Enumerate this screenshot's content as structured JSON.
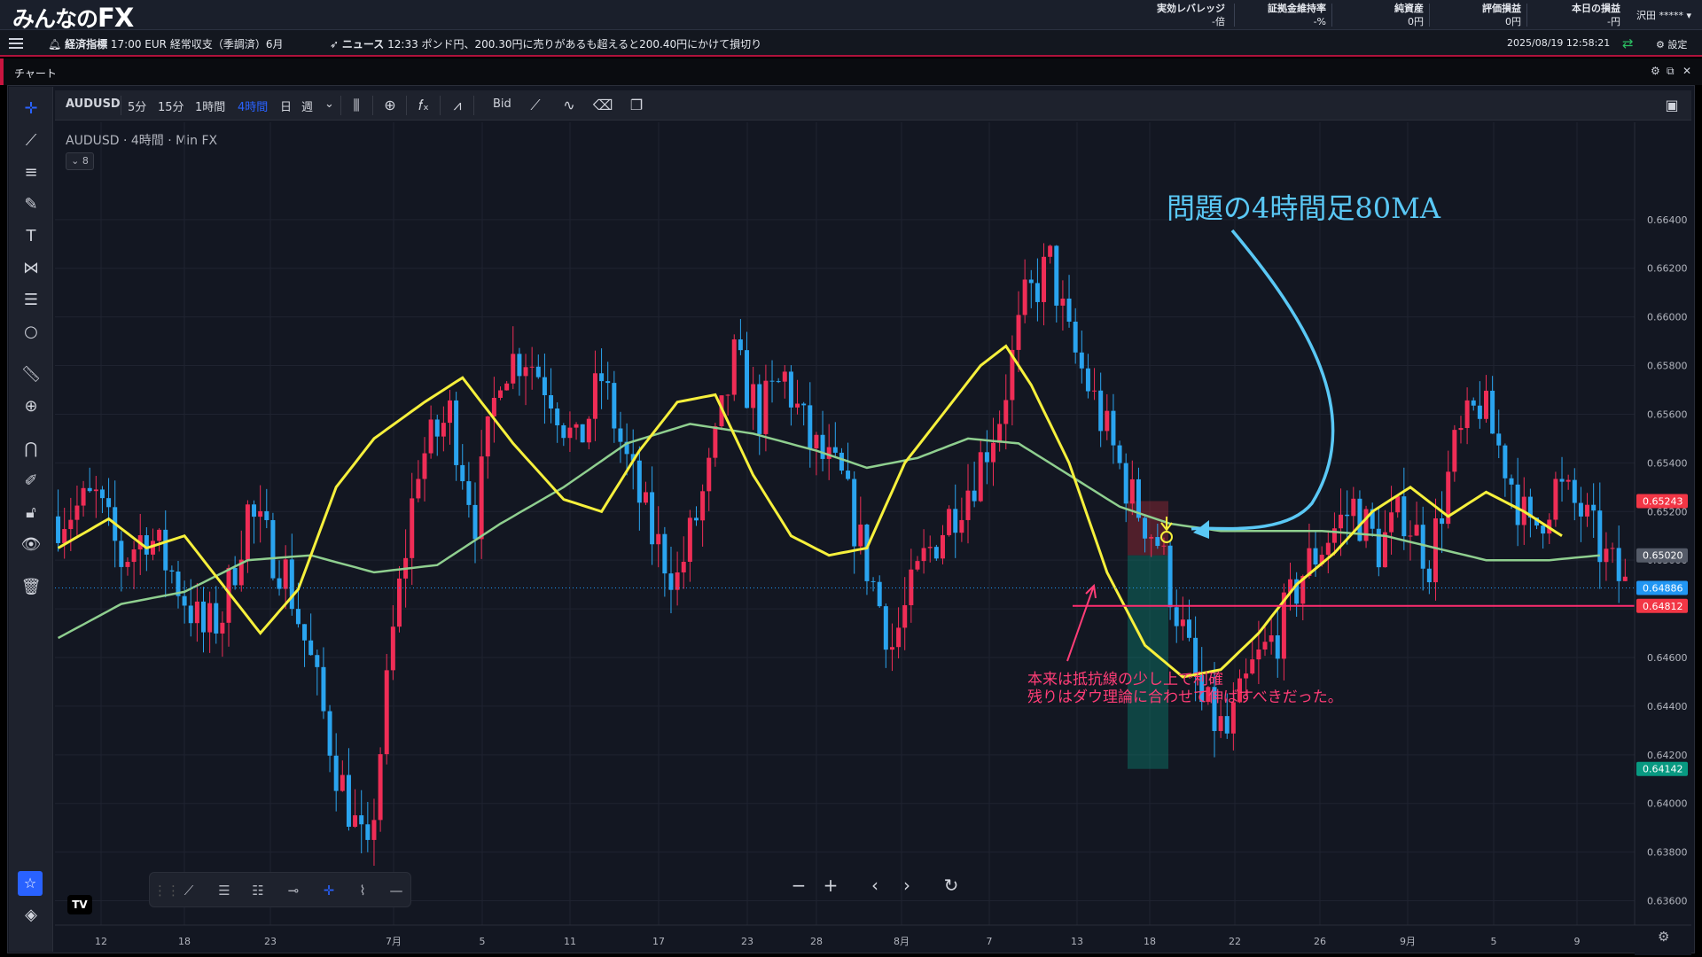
{
  "header": {
    "logo_prefix": "みんなの",
    "logo_suffix": "FX",
    "account": [
      {
        "label": "実効レバレッジ",
        "value": "-倍"
      },
      {
        "label": "証拠金維持率",
        "value": "-%"
      },
      {
        "label": "純資産",
        "value": "0円"
      },
      {
        "label": "評価損益",
        "value": "0円"
      },
      {
        "label": "本日の損益",
        "value": "-円"
      }
    ],
    "user": "沢田 ***** ▾"
  },
  "ticker": {
    "econ_label": "経済指標",
    "econ_text": "17:00 EUR 経常収支（季調済）6月",
    "news_label": "ニュース",
    "news_text": "12:33 ポンド円、200.30円に売りがあるも超えると200.40円にかけて損切り",
    "datetime": "2025/08/19 12:58:21",
    "settings": "設定"
  },
  "panel": {
    "title": "チャート"
  },
  "toolbar": {
    "symbol": "AUDUSD",
    "intervals": [
      "5分",
      "15分",
      "1時間",
      "4時間",
      "日",
      "週"
    ],
    "active_interval": "4時間",
    "price_source": "Bid"
  },
  "legend": {
    "symbol": "AUDUSD",
    "interval": "4時間",
    "source": "Min FX",
    "indicator_count": "8"
  },
  "colors": {
    "up": "#ef2d56",
    "down": "#2aa4ef",
    "ma_short": "#f6f03c",
    "ma_long": "#8fcf8f",
    "note_title": "#5ac8f5",
    "note_body": "#ff3d77",
    "support": "#ff2d6f"
  },
  "annotations": {
    "ma_note": "問題の4時間足80MA",
    "tp_note_line1": "本来は抵抗線の少し上で利確",
    "tp_note_line2": "残りはダウ理論に合わせて伸ばすべきだった。"
  },
  "chart_data": {
    "type": "candlestick",
    "symbol": "AUDUSD",
    "ylim": [
      0.635,
      0.668
    ],
    "y_ticks": [
      "0.66400",
      "0.66200",
      "0.66000",
      "0.65800",
      "0.65600",
      "0.65400",
      "0.65200",
      "0.65000",
      "0.64800",
      "0.64600",
      "0.64400",
      "0.64200",
      "0.64000",
      "0.63800",
      "0.63600"
    ],
    "x_ticks": [
      "12",
      "18",
      "23",
      "7月",
      "5",
      "11",
      "17",
      "23",
      "28",
      "8月",
      "7",
      "13",
      "18",
      "22",
      "26",
      "9月",
      "5",
      "9"
    ],
    "price_labels": [
      {
        "value": "0.65243",
        "color": "#f23645",
        "text_color": "#ffffff"
      },
      {
        "value": "0.65020",
        "color": "#555b68",
        "text_color": "#ffffff"
      },
      {
        "value": "0.64886",
        "color": "#2196f3",
        "text_color": "#ffffff"
      },
      {
        "value": "0.64812",
        "color": "#f23645",
        "text_color": "#ffffff"
      },
      {
        "value": "0.64142",
        "color": "#089981",
        "text_color": "#ffffff"
      }
    ],
    "support_level": 0.64812,
    "current_price": 0.64886,
    "position_box": {
      "entry": 0.6502,
      "stop": 0.65243,
      "target": 0.64142
    },
    "price_path": [
      [
        0,
        0.6518
      ],
      [
        6,
        0.6525
      ],
      [
        10,
        0.65
      ],
      [
        14,
        0.6512
      ],
      [
        18,
        0.6495
      ],
      [
        23,
        0.647
      ],
      [
        26,
        0.6478
      ],
      [
        30,
        0.652
      ],
      [
        36,
        0.6495
      ],
      [
        40,
        0.6458
      ],
      [
        44,
        0.6415
      ],
      [
        49,
        0.6375
      ],
      [
        53,
        0.647
      ],
      [
        57,
        0.654
      ],
      [
        62,
        0.656
      ],
      [
        66,
        0.6518
      ],
      [
        70,
        0.658
      ],
      [
        74,
        0.6585
      ],
      [
        78,
        0.657
      ],
      [
        82,
        0.6545
      ],
      [
        86,
        0.6575
      ],
      [
        90,
        0.654
      ],
      [
        94,
        0.651
      ],
      [
        98,
        0.6492
      ],
      [
        103,
        0.6535
      ],
      [
        107,
        0.6582
      ],
      [
        111,
        0.656
      ],
      [
        115,
        0.6575
      ],
      [
        119,
        0.6548
      ],
      [
        124,
        0.6532
      ],
      [
        128,
        0.6498
      ],
      [
        132,
        0.6465
      ],
      [
        137,
        0.65
      ],
      [
        141,
        0.6518
      ],
      [
        145,
        0.6535
      ],
      [
        149,
        0.656
      ],
      [
        153,
        0.6605
      ],
      [
        157,
        0.6622
      ],
      [
        160,
        0.659
      ],
      [
        163,
        0.6572
      ],
      [
        167,
        0.6545
      ],
      [
        170,
        0.6525
      ],
      [
        174,
        0.6508
      ],
      [
        178,
        0.647
      ],
      [
        181,
        0.644
      ],
      [
        185,
        0.6428
      ],
      [
        189,
        0.6455
      ],
      [
        193,
        0.647
      ],
      [
        197,
        0.6495
      ],
      [
        201,
        0.651
      ],
      [
        205,
        0.6522
      ],
      [
        209,
        0.6505
      ],
      [
        213,
        0.652
      ],
      [
        217,
        0.65
      ],
      [
        221,
        0.6545
      ],
      [
        225,
        0.6565
      ],
      [
        229,
        0.654
      ],
      [
        233,
        0.651
      ],
      [
        237,
        0.653
      ],
      [
        241,
        0.652
      ],
      [
        245,
        0.65
      ],
      [
        248,
        0.6489
      ]
    ],
    "ma_short_path": [
      [
        0,
        0.6505
      ],
      [
        8,
        0.6517
      ],
      [
        14,
        0.6505
      ],
      [
        20,
        0.651
      ],
      [
        26,
        0.649
      ],
      [
        32,
        0.647
      ],
      [
        38,
        0.6488
      ],
      [
        44,
        0.653
      ],
      [
        50,
        0.655
      ],
      [
        58,
        0.6565
      ],
      [
        64,
        0.6575
      ],
      [
        72,
        0.6548
      ],
      [
        80,
        0.6525
      ],
      [
        86,
        0.652
      ],
      [
        92,
        0.6545
      ],
      [
        98,
        0.6565
      ],
      [
        104,
        0.6568
      ],
      [
        110,
        0.6535
      ],
      [
        116,
        0.651
      ],
      [
        122,
        0.6502
      ],
      [
        128,
        0.6505
      ],
      [
        134,
        0.654
      ],
      [
        140,
        0.656
      ],
      [
        146,
        0.658
      ],
      [
        150,
        0.6588
      ],
      [
        154,
        0.6572
      ],
      [
        160,
        0.654
      ],
      [
        166,
        0.6495
      ],
      [
        172,
        0.6465
      ],
      [
        178,
        0.6452
      ],
      [
        184,
        0.6455
      ],
      [
        190,
        0.647
      ],
      [
        196,
        0.649
      ],
      [
        202,
        0.6503
      ],
      [
        208,
        0.652
      ],
      [
        214,
        0.653
      ],
      [
        220,
        0.6518
      ],
      [
        226,
        0.6528
      ],
      [
        232,
        0.652
      ],
      [
        238,
        0.651
      ]
    ],
    "ma_long_path": [
      [
        0,
        0.6468
      ],
      [
        10,
        0.6482
      ],
      [
        20,
        0.6487
      ],
      [
        30,
        0.65
      ],
      [
        40,
        0.6502
      ],
      [
        50,
        0.6495
      ],
      [
        60,
        0.6498
      ],
      [
        70,
        0.6515
      ],
      [
        80,
        0.653
      ],
      [
        90,
        0.6548
      ],
      [
        100,
        0.6556
      ],
      [
        110,
        0.6552
      ],
      [
        120,
        0.6545
      ],
      [
        128,
        0.6538
      ],
      [
        136,
        0.6542
      ],
      [
        144,
        0.655
      ],
      [
        152,
        0.6548
      ],
      [
        160,
        0.6535
      ],
      [
        168,
        0.6522
      ],
      [
        176,
        0.6515
      ],
      [
        184,
        0.6512
      ],
      [
        192,
        0.6512
      ],
      [
        200,
        0.6512
      ],
      [
        210,
        0.651
      ],
      [
        218,
        0.6505
      ],
      [
        226,
        0.65
      ],
      [
        236,
        0.65
      ],
      [
        244,
        0.6502
      ]
    ]
  }
}
